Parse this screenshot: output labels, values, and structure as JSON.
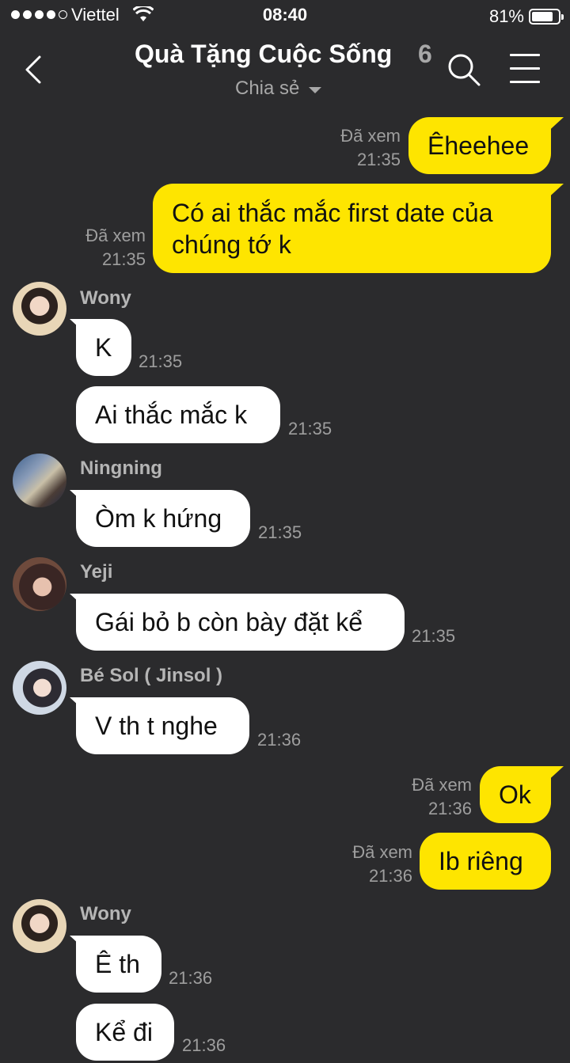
{
  "status_bar": {
    "carrier": "Viettel",
    "time": "08:40",
    "battery": "81%"
  },
  "header": {
    "title": "Quà Tặng Cuộc Sống",
    "member_count": "6",
    "subtitle": "Chia sẻ"
  },
  "messages": [
    {
      "side": "out",
      "text": "Êheehee",
      "read": "Đã xem",
      "time": "21:35"
    },
    {
      "side": "out",
      "text": "Có ai thắc mắc first date của chúng tớ k",
      "read": "Đã xem",
      "time": "21:35"
    },
    {
      "side": "in",
      "sender": "Wony",
      "text": "K",
      "time": "21:35"
    },
    {
      "side": "in",
      "sender": "Wony",
      "text": "Ai thắc mắc k",
      "time": "21:35"
    },
    {
      "side": "in",
      "sender": "Ningning",
      "text": "Òm k hứng",
      "time": "21:35"
    },
    {
      "side": "in",
      "sender": "Yeji",
      "text": "Gái bỏ b còn bày đặt kể",
      "time": "21:35"
    },
    {
      "side": "in",
      "sender": "Bé Sol ( Jinsol )",
      "text": "V th t nghe",
      "time": "21:36"
    },
    {
      "side": "out",
      "text": "Ok",
      "read": "Đã xem",
      "time": "21:36"
    },
    {
      "side": "out",
      "text": "Ib riêng",
      "read": "Đã xem",
      "time": "21:36"
    },
    {
      "side": "in",
      "sender": "Wony",
      "text": "Ê th",
      "time": "21:36"
    },
    {
      "side": "in",
      "sender": "Wony",
      "text": "Kể đi",
      "time": "21:36"
    }
  ],
  "colors": {
    "background": "#2b2b2d",
    "outgoing_bubble": "#fee500",
    "incoming_bubble": "#ffffff"
  }
}
